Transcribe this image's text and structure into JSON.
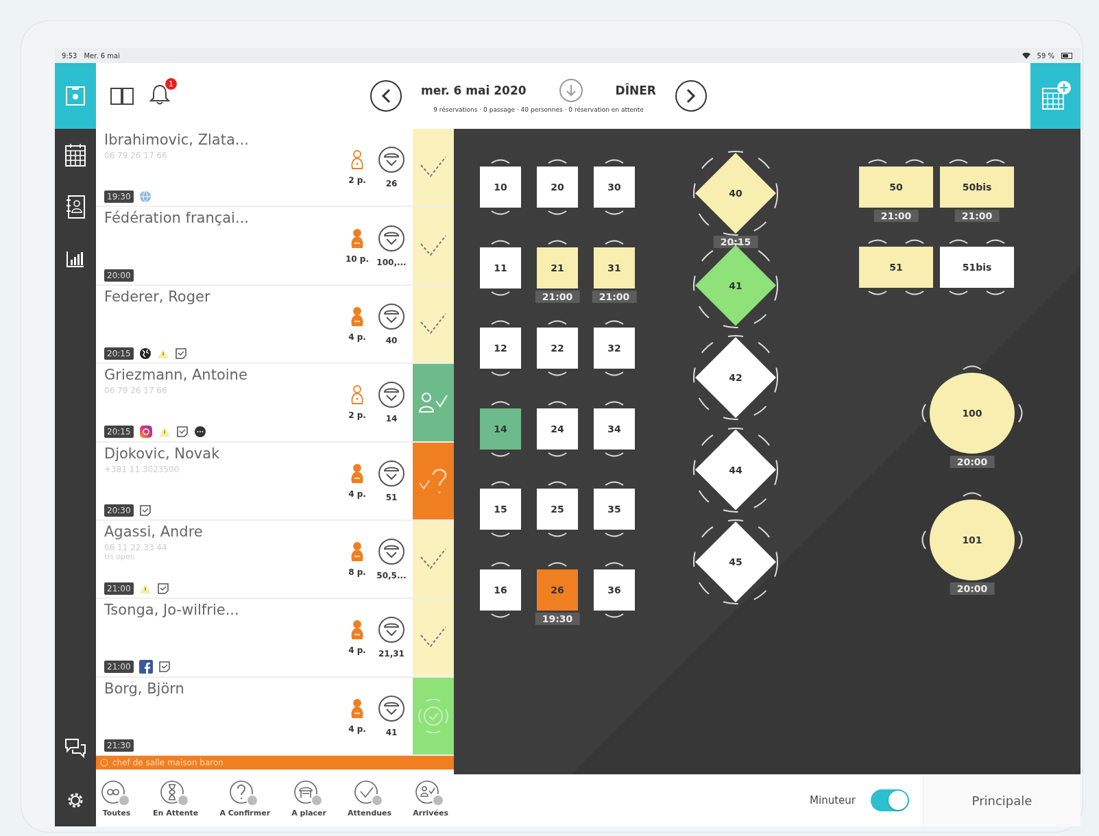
{
  "status_bar": {
    "time": "9:53",
    "date": "Mer. 6 mai",
    "battery": "59 %"
  },
  "header": {
    "notification_count": "1",
    "date": "mer. 6 mai 2020",
    "service": "DÎNER",
    "summary": "9 réservations · 0 passage · 40 personnes · 0 réservation en attente"
  },
  "reservations": [
    {
      "name": "Ibrahimovic, Zlata...",
      "phone": "06 79 26 17 66",
      "time": "19:30",
      "icons": [
        {
          "kind": "web"
        }
      ],
      "guest_icon": {
        "kind": "outline"
      },
      "party": "2 p.",
      "table": "26",
      "status": {
        "kind": "expected"
      }
    },
    {
      "name": "Fédération françai...",
      "time": "20:00",
      "guest_icon": {
        "kind": "filled"
      },
      "party": "10 p.",
      "table": "100,...",
      "status": {
        "kind": "expected"
      }
    },
    {
      "name": "Federer, Roger",
      "time": "20:15",
      "icons": [
        {
          "kind": "globe"
        },
        {
          "kind": "warning"
        },
        {
          "kind": "note"
        }
      ],
      "guest_icon": {
        "kind": "filled"
      },
      "party": "4 p.",
      "table": "40",
      "status": {
        "kind": "expected"
      }
    },
    {
      "name": "Griezmann, Antoine",
      "phone": "06 79 26 17 66",
      "time": "20:15",
      "icons": [
        {
          "kind": "instagram"
        },
        {
          "kind": "warning"
        },
        {
          "kind": "note"
        },
        {
          "kind": "chat"
        }
      ],
      "guest_icon": {
        "kind": "outline"
      },
      "party": "2 p.",
      "table": "14",
      "status": {
        "kind": "arrived"
      }
    },
    {
      "name": "Djokovic, Novak",
      "phone": "+381 11 3023500",
      "time": "20:30",
      "icons": [
        {
          "kind": "note"
        }
      ],
      "guest_icon": {
        "kind": "filled"
      },
      "party": "4 p.",
      "table": "51",
      "status": {
        "kind": "to_confirm"
      }
    },
    {
      "name": "Agassi, Andre",
      "phone": "06 11 22 33 44",
      "note": "Us open",
      "time": "21:00",
      "icons": [
        {
          "kind": "warning"
        },
        {
          "kind": "note"
        }
      ],
      "guest_icon": {
        "kind": "filled"
      },
      "party": "8 p.",
      "table": "50,5...",
      "status": {
        "kind": "expected"
      }
    },
    {
      "name": "Tsonga, Jo-wilfrie...",
      "time": "21:00",
      "icons": [
        {
          "kind": "facebook"
        },
        {
          "kind": "note"
        }
      ],
      "guest_icon": {
        "kind": "filled"
      },
      "party": "4 p.",
      "table": "21,31",
      "status": {
        "kind": "expected"
      }
    },
    {
      "name": "Borg, Björn",
      "time": "21:30",
      "guest_icon": {
        "kind": "filled"
      },
      "party": "4 p.",
      "table": "41",
      "status": {
        "kind": "seated"
      }
    }
  ],
  "notice": "chef de salle maison baron",
  "filters": [
    {
      "label": "Toutes",
      "kind": "all"
    },
    {
      "label": "En Attente",
      "kind": "waiting"
    },
    {
      "label": "A Confirmer",
      "kind": "confirm"
    },
    {
      "label": "A placer",
      "kind": "place"
    },
    {
      "label": "Attendues",
      "kind": "expected"
    },
    {
      "label": "Arrivées",
      "kind": "arrived"
    }
  ],
  "tables": [
    {
      "number": "10",
      "kind": "square",
      "color": "#ffffff"
    },
    {
      "number": "11",
      "kind": "square",
      "color": "#ffffff"
    },
    {
      "number": "12",
      "kind": "square",
      "color": "#ffffff"
    },
    {
      "number": "14",
      "kind": "square",
      "color": "#6dbb8a"
    },
    {
      "number": "15",
      "kind": "square",
      "color": "#ffffff"
    },
    {
      "number": "16",
      "kind": "square",
      "color": "#ffffff"
    },
    {
      "number": "20",
      "kind": "square",
      "color": "#ffffff"
    },
    {
      "number": "21",
      "kind": "square",
      "color": "#f7eeb0",
      "time": "21:00"
    },
    {
      "number": "22",
      "kind": "square",
      "color": "#ffffff"
    },
    {
      "number": "24",
      "kind": "square",
      "color": "#ffffff"
    },
    {
      "number": "25",
      "kind": "square",
      "color": "#ffffff"
    },
    {
      "number": "26",
      "kind": "square",
      "color": "#f07f22",
      "time": "19:30"
    },
    {
      "number": "30",
      "kind": "square",
      "color": "#ffffff"
    },
    {
      "number": "31",
      "kind": "square",
      "color": "#f7eeb0",
      "time": "21:00"
    },
    {
      "number": "32",
      "kind": "square",
      "color": "#ffffff"
    },
    {
      "number": "34",
      "kind": "square",
      "color": "#ffffff"
    },
    {
      "number": "35",
      "kind": "square",
      "color": "#ffffff"
    },
    {
      "number": "36",
      "kind": "square",
      "color": "#ffffff"
    },
    {
      "number": "40",
      "kind": "diamond",
      "color": "#f7eeb0",
      "time": "20:15"
    },
    {
      "number": "41",
      "kind": "diamond",
      "color": "#8fe27a"
    },
    {
      "number": "42",
      "kind": "diamond",
      "color": "#ffffff"
    },
    {
      "number": "44",
      "kind": "diamond",
      "color": "#ffffff"
    },
    {
      "number": "45",
      "kind": "diamond",
      "color": "#ffffff"
    },
    {
      "number": "50",
      "kind": "rect",
      "color": "#f7eeb0",
      "time": "21:00"
    },
    {
      "number": "50bis",
      "kind": "rect",
      "color": "#f7eeb0",
      "time": "21:00"
    },
    {
      "number": "51",
      "kind": "rect",
      "color": "#f7eeb0"
    },
    {
      "number": "51bis",
      "kind": "rect",
      "color": "#ffffff"
    },
    {
      "number": "100",
      "kind": "round",
      "color": "#f7eeb0",
      "time": "20:00"
    },
    {
      "number": "101",
      "kind": "round",
      "color": "#f7eeb0",
      "time": "20:00"
    }
  ],
  "footer": {
    "timer_label": "Minuteur",
    "timer_on": true,
    "room": "Principale"
  }
}
